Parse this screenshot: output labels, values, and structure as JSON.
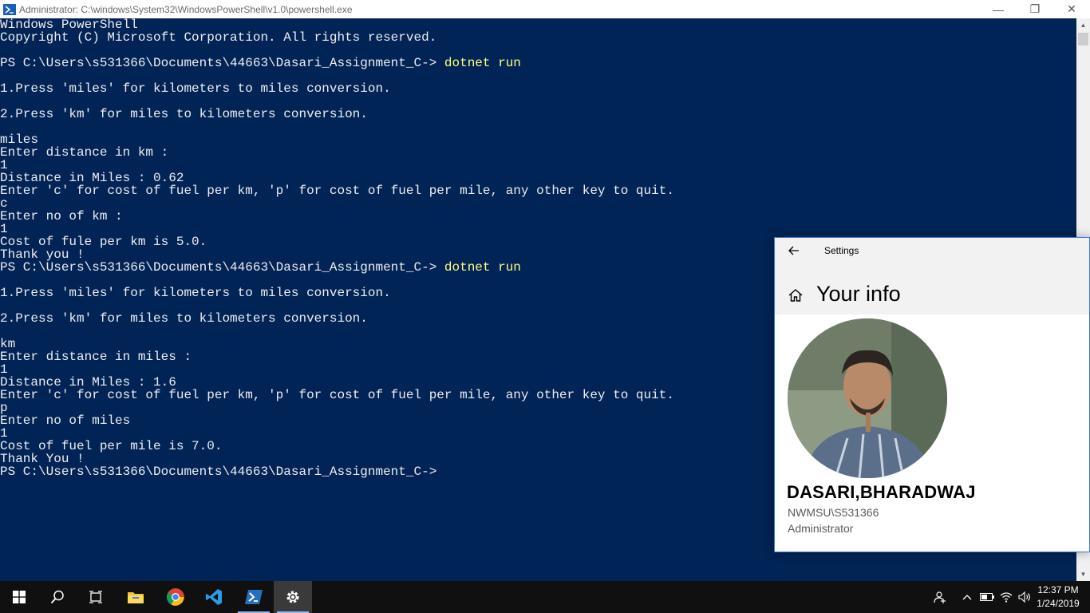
{
  "window": {
    "title": "Administrator: C:\\windows\\System32\\WindowsPowerShell\\v1.0\\powershell.exe",
    "minimize_glyph": "—",
    "restore_glyph": "❐",
    "close_glyph": "✕"
  },
  "console": {
    "lines": [
      {
        "text": "Windows PowerShell"
      },
      {
        "text": "Copyright (C) Microsoft Corporation. All rights reserved."
      },
      {
        "text": ""
      },
      {
        "prompt": "PS C:\\Users\\s531366\\Documents\\44663\\Dasari_Assignment_C-> ",
        "cmd": "dotnet run"
      },
      {
        "text": ""
      },
      {
        "text": "1.Press 'miles' for kilometers to miles conversion."
      },
      {
        "text": ""
      },
      {
        "text": "2.Press 'km' for miles to kilometers conversion."
      },
      {
        "text": ""
      },
      {
        "text": "miles"
      },
      {
        "text": "Enter distance in km :"
      },
      {
        "text": "1"
      },
      {
        "text": "Distance in Miles : 0.62"
      },
      {
        "text": "Enter 'c' for cost of fuel per km, 'p' for cost of fuel per mile, any other key to quit."
      },
      {
        "text": "c"
      },
      {
        "text": "Enter no of km :"
      },
      {
        "text": "1"
      },
      {
        "text": "Cost of fule per km is 5.0."
      },
      {
        "text": "Thank you !"
      },
      {
        "prompt": "PS C:\\Users\\s531366\\Documents\\44663\\Dasari_Assignment_C-> ",
        "cmd": "dotnet run"
      },
      {
        "text": ""
      },
      {
        "text": "1.Press 'miles' for kilometers to miles conversion."
      },
      {
        "text": ""
      },
      {
        "text": "2.Press 'km' for miles to kilometers conversion."
      },
      {
        "text": ""
      },
      {
        "text": "km"
      },
      {
        "text": "Enter distance in miles :"
      },
      {
        "text": "1"
      },
      {
        "text": "Distance in Miles : 1.6"
      },
      {
        "text": "Enter 'c' for cost of fuel per km, 'p' for cost of fuel per mile, any other key to quit."
      },
      {
        "text": "p"
      },
      {
        "text": "Enter no of miles"
      },
      {
        "text": "1"
      },
      {
        "text": "Cost of fuel per mile is 7.0."
      },
      {
        "text": "Thank You !"
      },
      {
        "prompt": "PS C:\\Users\\s531366\\Documents\\44663\\Dasari_Assignment_C->",
        "cmd": ""
      }
    ]
  },
  "settings": {
    "app_title": "Settings",
    "page_title": "Your info",
    "user_name": "DASARI,BHARADWAJ",
    "account": "NWMSU\\S531366",
    "role": "Administrator"
  },
  "taskbar": {
    "items": [
      "start",
      "search",
      "task-view",
      "file-explorer",
      "chrome",
      "visual-studio-code",
      "powershell",
      "settings"
    ],
    "time": "12:37 PM",
    "date": "1/24/2019"
  },
  "colors": {
    "console_bg": "#012456",
    "console_fg": "#eeedf0",
    "command_fg": "#ffff80",
    "accent": "#3b78d8"
  }
}
